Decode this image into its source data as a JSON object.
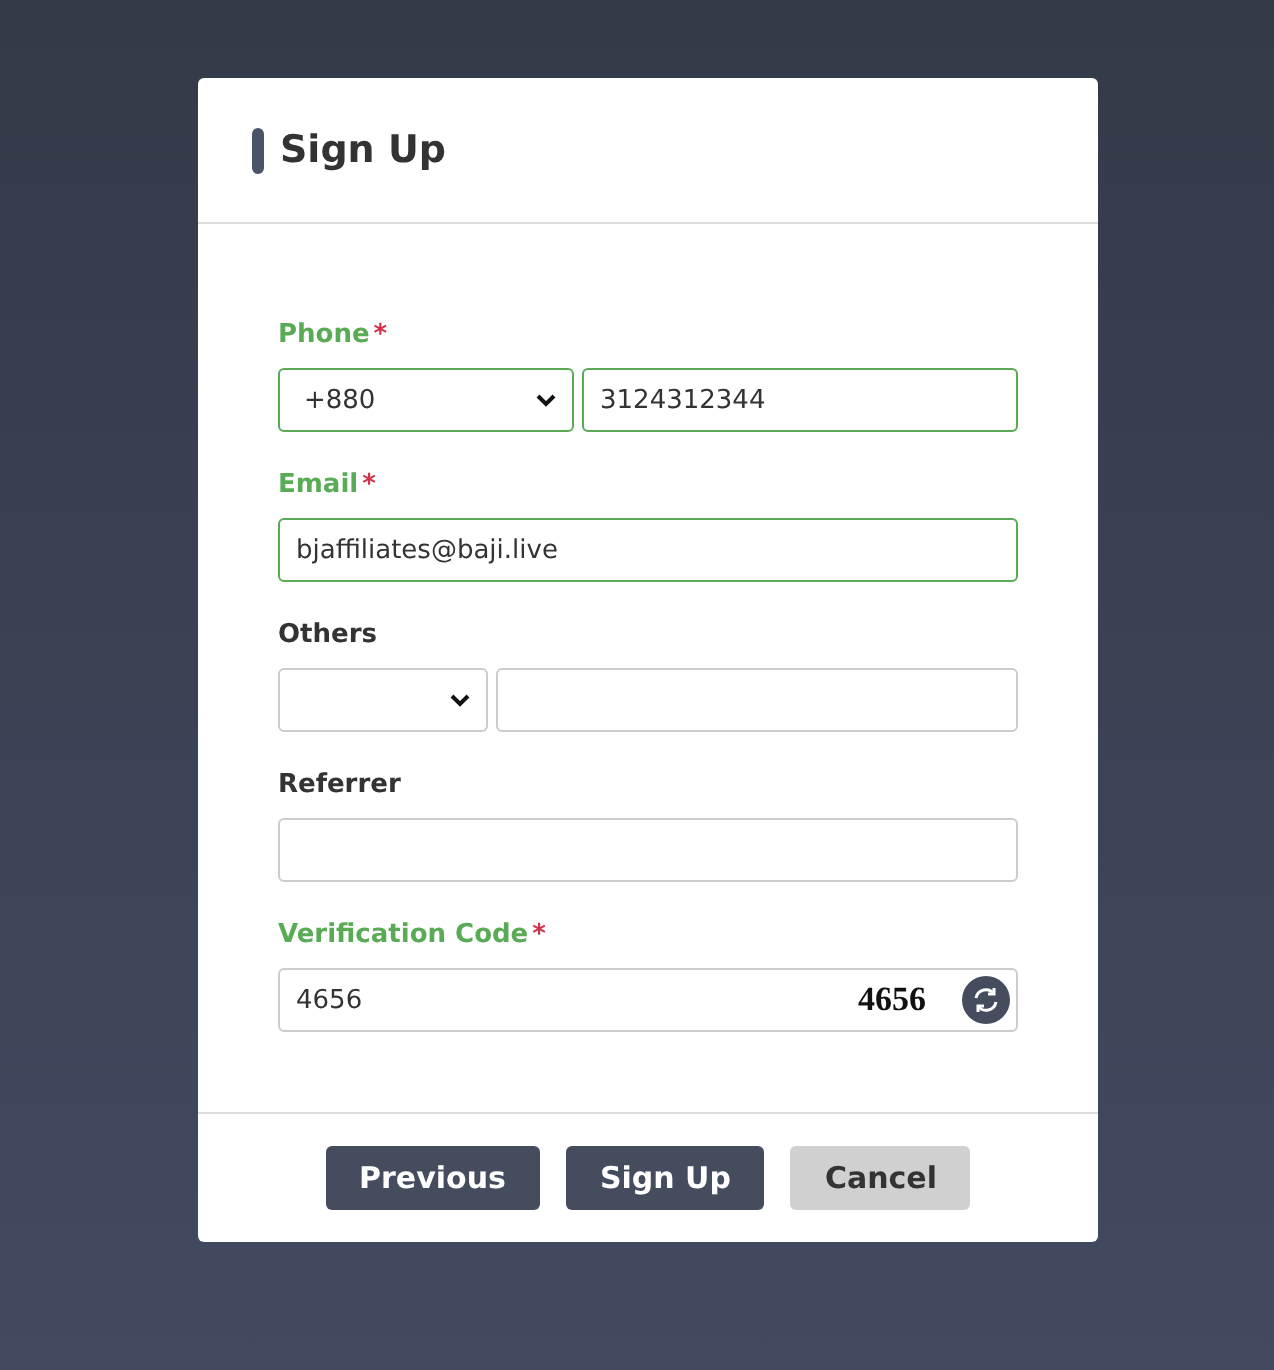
{
  "dialog": {
    "title": "Sign Up"
  },
  "fields": [
    {
      "kind": "combo",
      "label": "Phone",
      "required_mark": "*",
      "valid": true,
      "select_value": "+880",
      "value": "3124312344"
    },
    {
      "kind": "text",
      "label": "Email",
      "required_mark": "*",
      "valid": true,
      "value": "bjaffiliates@baji.live"
    },
    {
      "kind": "combo",
      "label": "Others",
      "valid": false
    },
    {
      "kind": "text",
      "label": "Referrer",
      "valid": false
    },
    {
      "kind": "captcha",
      "label": "Verification Code",
      "required_mark": "*",
      "valid": false,
      "value": "4656",
      "captcha": "4656"
    }
  ],
  "buttons": [
    {
      "label": "Previous",
      "kind": "primary"
    },
    {
      "label": "Sign Up",
      "kind": "primary"
    },
    {
      "label": "Cancel",
      "kind": "secondary"
    }
  ]
}
